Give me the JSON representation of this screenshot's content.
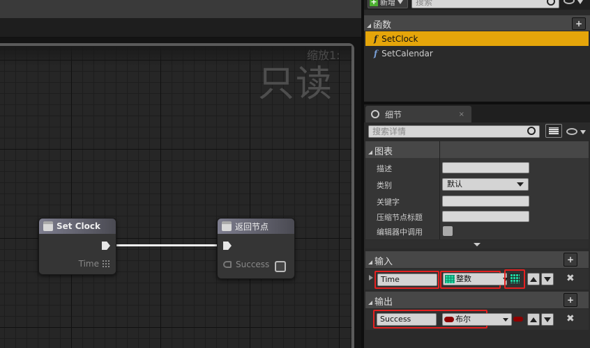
{
  "graph": {
    "zoom_label": "缩放1:",
    "readonly_label": "只读",
    "node_setclock": {
      "title": "Set Clock",
      "pin": "Time"
    },
    "node_return": {
      "title": "返回节点",
      "pin": "Success"
    }
  },
  "toolbar": {
    "new_label": "新增",
    "search_placeholder": "搜索"
  },
  "functions": {
    "header": "函数",
    "items": [
      {
        "label": "SetClock",
        "selected": true
      },
      {
        "label": "SetCalendar",
        "selected": false
      }
    ]
  },
  "details": {
    "tab_label": "细节",
    "search_placeholder": "搜索详情",
    "graph_section": "图表",
    "props": [
      {
        "label": "描述"
      },
      {
        "label": "类别",
        "value": "默认"
      },
      {
        "label": "关键字"
      },
      {
        "label": "压缩节点标题"
      },
      {
        "label": "编辑器中调用"
      }
    ],
    "inputs_section": "输入",
    "input_param": {
      "name": "Time",
      "type": "整数"
    },
    "outputs_section": "输出",
    "output_param": {
      "name": "Success",
      "type": "布尔"
    }
  },
  "colors": {
    "selected": "#e5a50a",
    "int_type": "#1fd4a0",
    "bool_type": "#8c0000",
    "highlight": "#e52020"
  }
}
